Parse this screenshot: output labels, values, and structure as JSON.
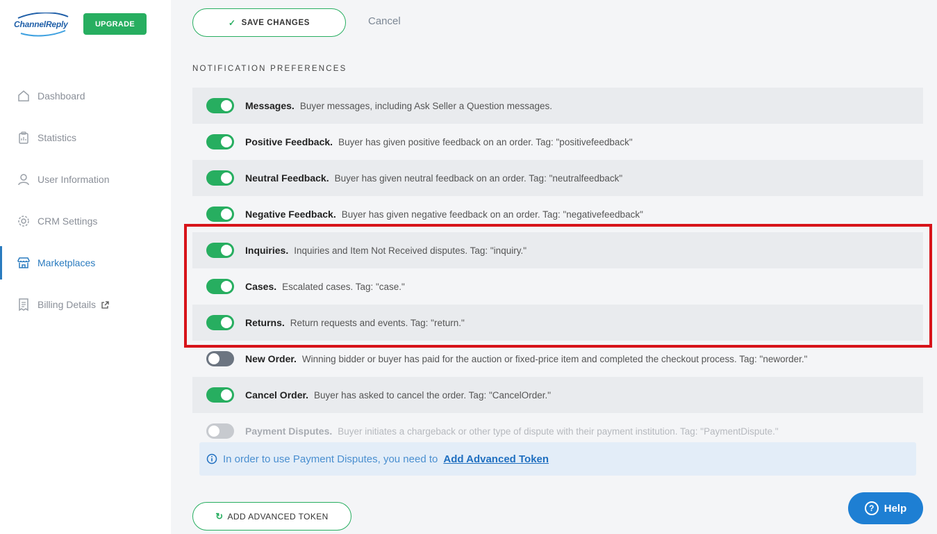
{
  "brand": {
    "logo_text": "ChannelReply",
    "upgrade_label": "UPGRADE",
    "accent_color": "#27ae60"
  },
  "sidebar": {
    "items": [
      {
        "label": "Dashboard",
        "icon": "home-icon"
      },
      {
        "label": "Statistics",
        "icon": "clipboard-icon"
      },
      {
        "label": "User Information",
        "icon": "user-icon"
      },
      {
        "label": "CRM Settings",
        "icon": "gear-icon"
      },
      {
        "label": "Marketplaces",
        "icon": "store-icon",
        "active": true
      },
      {
        "label": "Billing Details",
        "icon": "receipt-icon",
        "external": true
      }
    ]
  },
  "toolbar": {
    "save_label": "SAVE CHANGES",
    "cancel_label": "Cancel"
  },
  "section": {
    "title": "NOTIFICATION PREFERENCES"
  },
  "preferences": [
    {
      "name": "Messages.",
      "description": "Buyer messages, including Ask Seller a Question messages.",
      "state": "on"
    },
    {
      "name": "Positive Feedback.",
      "description": "Buyer has given positive feedback on an order. Tag: \"positivefeedback\"",
      "state": "on"
    },
    {
      "name": "Neutral Feedback.",
      "description": "Buyer has given neutral feedback on an order. Tag: \"neutralfeedback\"",
      "state": "on"
    },
    {
      "name": "Negative Feedback.",
      "description": "Buyer has given negative feedback on an order. Tag: \"negativefeedback\"",
      "state": "on"
    },
    {
      "name": "Inquiries.",
      "description": "Inquiries and Item Not Received disputes. Tag: \"inquiry.\"",
      "state": "on"
    },
    {
      "name": "Cases.",
      "description": "Escalated cases. Tag: \"case.\"",
      "state": "on"
    },
    {
      "name": "Returns.",
      "description": "Return requests and events. Tag: \"return.\"",
      "state": "on"
    },
    {
      "name": "New Order.",
      "description": "Winning bidder or buyer has paid for the auction or fixed-price item and completed the checkout process. Tag: \"neworder.\"",
      "state": "off"
    },
    {
      "name": "Cancel Order.",
      "description": "Buyer has asked to cancel the order. Tag: \"CancelOrder.\"",
      "state": "on"
    },
    {
      "name": "Payment Disputes.",
      "description": "Buyer initiates a chargeback or other type of dispute with their payment institution. Tag: \"PaymentDispute.\"",
      "state": "disabled"
    }
  ],
  "info": {
    "text": "In order to use Payment Disputes, you need to",
    "link_label": "Add Advanced Token"
  },
  "actions": {
    "add_token_label": "ADD ADVANCED TOKEN",
    "help_label": "Help"
  }
}
